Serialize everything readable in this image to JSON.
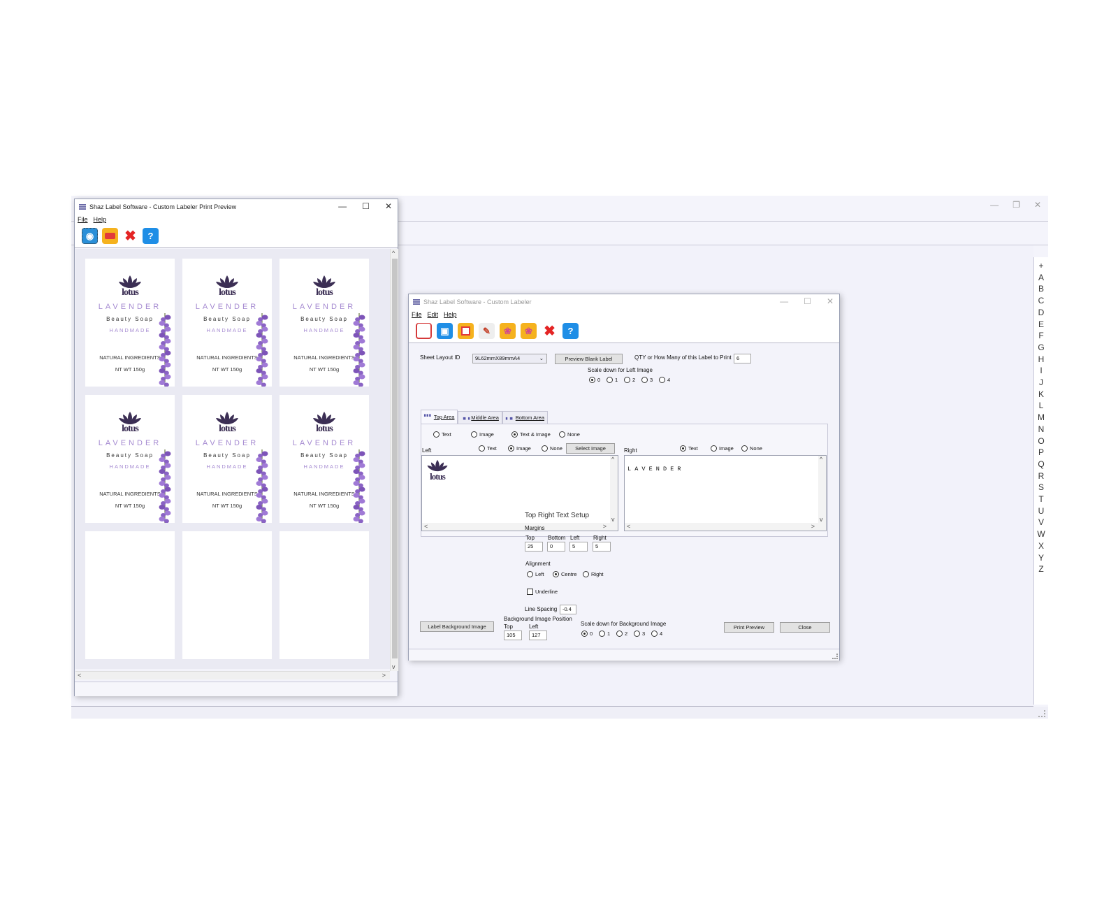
{
  "main": {
    "alphabet": [
      "+",
      "A",
      "B",
      "C",
      "D",
      "E",
      "F",
      "G",
      "H",
      "I",
      "J",
      "K",
      "L",
      "M",
      "N",
      "O",
      "P",
      "Q",
      "R",
      "S",
      "T",
      "U",
      "V",
      "W",
      "X",
      "Y",
      "Z"
    ]
  },
  "preview": {
    "title": "Shaz Label Software - Custom Labeler Print Preview",
    "menu": [
      "File",
      "Help"
    ],
    "label": {
      "brand": "lotus",
      "title": "LAVENDER",
      "subtitle": "Beauty Soap",
      "handmade": "HANDMADE",
      "ingredients": "NATURAL INGREDIENTS",
      "weight": "NT WT 150g"
    },
    "filled_labels": 6,
    "empty_labels": 3
  },
  "labeler": {
    "title": "Shaz Label Software - Custom Labeler",
    "menu": [
      "File",
      "Edit",
      "Help"
    ],
    "sheet_layout_label": "Sheet Layout ID",
    "sheet_layout_value": "9L62mmX89mmA4",
    "preview_blank_label": "Preview Blank Label",
    "qty_label": "QTY or How Many of this Label to Print",
    "qty_value": "6",
    "scale_left_label": "Scale down for Left Image",
    "scale_options": [
      "0",
      "1",
      "2",
      "3",
      "4"
    ],
    "scale_left_selected": "0",
    "tabs": [
      "Top Area",
      "Middle Area",
      "Bottom Area"
    ],
    "active_tab": "Top Area",
    "area_mode": {
      "options": [
        "Text",
        "Image",
        "Text & Image",
        "None"
      ],
      "selected": "Text & Image"
    },
    "left": {
      "label": "Left",
      "options": [
        "Text",
        "Image",
        "None"
      ],
      "selected": "Image",
      "select_image": "Select Image",
      "content_image": "lotus"
    },
    "right": {
      "label": "Right",
      "options": [
        "Text",
        "Image",
        "None"
      ],
      "selected": "Text",
      "content_text": "L A V E N D E R"
    },
    "text_setup": {
      "title": "Top Right Text Setup",
      "margins_label": "Margins",
      "margin_labels": [
        "Top",
        "Bottom",
        "Left",
        "Right"
      ],
      "margin_values": [
        "25",
        "0",
        "5",
        "5"
      ],
      "alignment_label": "Alignment",
      "alignment_options": [
        "Left",
        "Centre",
        "Right"
      ],
      "alignment_selected": "Centre",
      "underline_label": "Underline",
      "underline_checked": false,
      "line_spacing_label": "Line Spacing",
      "line_spacing_value": "-0.4"
    },
    "background": {
      "button": "Label Background Image",
      "position_label": "Background Image Position",
      "top_label": "Top",
      "top_value": "105",
      "left_label": "Left",
      "left_value": "127",
      "scale_label": "Scale down for Background Image",
      "scale_selected": "0"
    },
    "print_preview": "Print Preview",
    "close": "Close"
  },
  "colors": {
    "label_purple": "#a58ad1",
    "logo_purple": "#3b2e54",
    "window_bg": "#f3f3fa"
  }
}
